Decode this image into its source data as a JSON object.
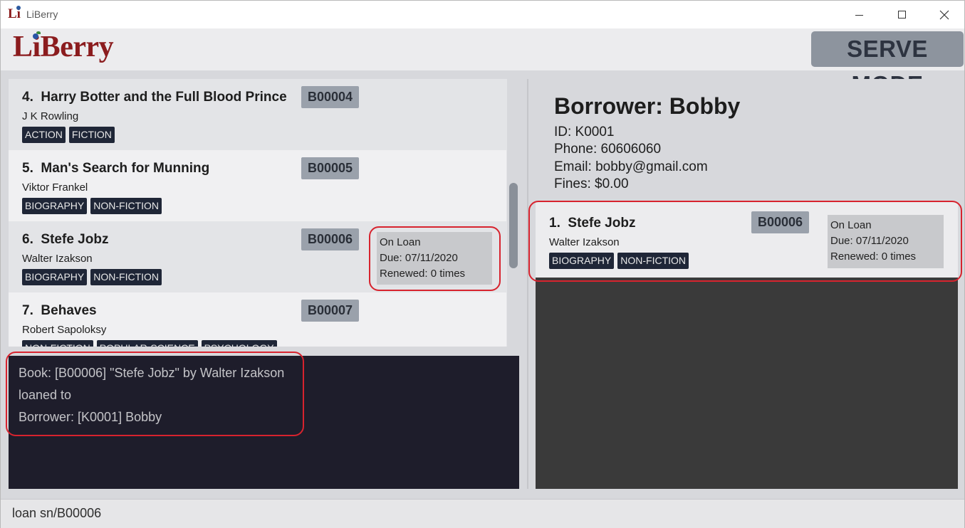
{
  "window": {
    "title": "LiBerry",
    "icon_text": "Li"
  },
  "header": {
    "logo_text": "LiBerry",
    "mode": "SERVE MODE"
  },
  "book_list": [
    {
      "index": "4.",
      "title": "Harry Botter and the Full Blood Prince",
      "author": "J K Rowling",
      "id": "B00004",
      "tags": [
        "ACTION",
        "FICTION"
      ],
      "loan": null
    },
    {
      "index": "5.",
      "title": "Man's Search for Munning",
      "author": "Viktor Frankel",
      "id": "B00005",
      "tags": [
        "BIOGRAPHY",
        "NON-FICTION"
      ],
      "loan": null
    },
    {
      "index": "6.",
      "title": "Stefe Jobz",
      "author": "Walter Izakson",
      "id": "B00006",
      "tags": [
        "BIOGRAPHY",
        "NON-FICTION"
      ],
      "loan": {
        "status": "On Loan",
        "due": "Due: 07/11/2020",
        "renewed": "Renewed: 0 times"
      }
    },
    {
      "index": "7.",
      "title": "Behaves",
      "author": "Robert Sapoloksy",
      "id": "B00007",
      "tags": [
        "NON-FICTION",
        "POPULAR-SCIENCE",
        "PSYCHOLOGY"
      ],
      "loan": null
    }
  ],
  "result": {
    "lines": [
      "Book: [B00006] \"Stefe Jobz\" by Walter Izakson",
      "loaned to",
      "Borrower: [K0001] Bobby"
    ]
  },
  "borrower": {
    "name": "Borrower: Bobby",
    "id": "ID: K0001",
    "phone": "Phone: 60606060",
    "email": "Email: bobby@gmail.com",
    "fines": "Fines: $0.00",
    "loans": [
      {
        "index": "1.",
        "title": "Stefe Jobz",
        "author": "Walter Izakson",
        "id": "B00006",
        "tags": [
          "BIOGRAPHY",
          "NON-FICTION"
        ],
        "loan": {
          "status": "On Loan",
          "due": "Due: 07/11/2020",
          "renewed": "Renewed: 0 times"
        }
      }
    ]
  },
  "command": {
    "value": "loan sn/B00006"
  },
  "colors": {
    "brand": "#8b1c1e",
    "annotation": "#d7232e",
    "tag_bg": "#1f2637",
    "id_badge": "#9aa1ab"
  },
  "icons": {
    "minimize": "minimize-icon",
    "maximize": "maximize-icon",
    "close": "close-icon"
  }
}
